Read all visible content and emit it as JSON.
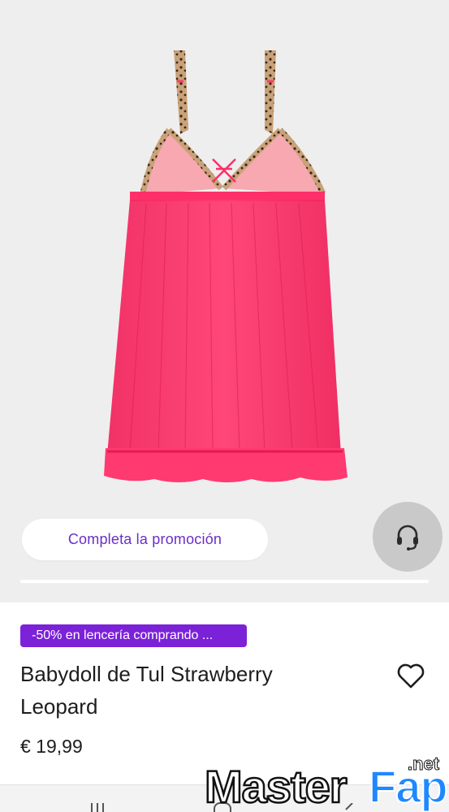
{
  "promo": {
    "label": "Completa la promoción"
  },
  "support": {
    "icon": "headset-icon"
  },
  "product": {
    "badge": "-50% en lencería comprando ...",
    "title": "Babydoll de Tul Strawberry Leopard",
    "price": "€ 19,99",
    "wishlist_icon": "heart-outline-icon"
  },
  "colors": {
    "accent": "#7b22d8",
    "promo_text": "#6b2fc4",
    "garment": "#ff2e6a"
  },
  "navbar": {
    "icons": [
      "recent-apps-icon",
      "home-icon",
      "back-icon"
    ]
  },
  "watermark": {
    "text": "MasterFap",
    "suffix": ".net"
  }
}
